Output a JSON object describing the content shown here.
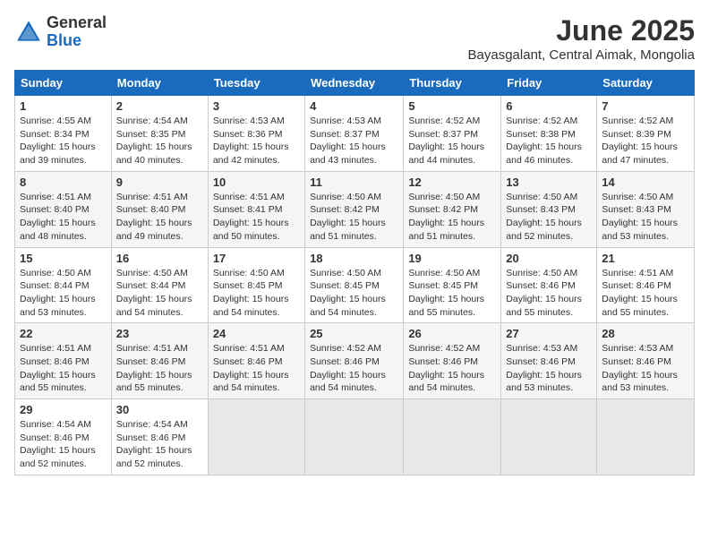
{
  "header": {
    "logo_general": "General",
    "logo_blue": "Blue",
    "month_year": "June 2025",
    "location": "Bayasgalant, Central Aimak, Mongolia"
  },
  "calendar": {
    "weekdays": [
      "Sunday",
      "Monday",
      "Tuesday",
      "Wednesday",
      "Thursday",
      "Friday",
      "Saturday"
    ],
    "weeks": [
      [
        {
          "day": "1",
          "info": "Sunrise: 4:55 AM\nSunset: 8:34 PM\nDaylight: 15 hours\nand 39 minutes."
        },
        {
          "day": "2",
          "info": "Sunrise: 4:54 AM\nSunset: 8:35 PM\nDaylight: 15 hours\nand 40 minutes."
        },
        {
          "day": "3",
          "info": "Sunrise: 4:53 AM\nSunset: 8:36 PM\nDaylight: 15 hours\nand 42 minutes."
        },
        {
          "day": "4",
          "info": "Sunrise: 4:53 AM\nSunset: 8:37 PM\nDaylight: 15 hours\nand 43 minutes."
        },
        {
          "day": "5",
          "info": "Sunrise: 4:52 AM\nSunset: 8:37 PM\nDaylight: 15 hours\nand 44 minutes."
        },
        {
          "day": "6",
          "info": "Sunrise: 4:52 AM\nSunset: 8:38 PM\nDaylight: 15 hours\nand 46 minutes."
        },
        {
          "day": "7",
          "info": "Sunrise: 4:52 AM\nSunset: 8:39 PM\nDaylight: 15 hours\nand 47 minutes."
        }
      ],
      [
        {
          "day": "8",
          "info": "Sunrise: 4:51 AM\nSunset: 8:40 PM\nDaylight: 15 hours\nand 48 minutes."
        },
        {
          "day": "9",
          "info": "Sunrise: 4:51 AM\nSunset: 8:40 PM\nDaylight: 15 hours\nand 49 minutes."
        },
        {
          "day": "10",
          "info": "Sunrise: 4:51 AM\nSunset: 8:41 PM\nDaylight: 15 hours\nand 50 minutes."
        },
        {
          "day": "11",
          "info": "Sunrise: 4:50 AM\nSunset: 8:42 PM\nDaylight: 15 hours\nand 51 minutes."
        },
        {
          "day": "12",
          "info": "Sunrise: 4:50 AM\nSunset: 8:42 PM\nDaylight: 15 hours\nand 51 minutes."
        },
        {
          "day": "13",
          "info": "Sunrise: 4:50 AM\nSunset: 8:43 PM\nDaylight: 15 hours\nand 52 minutes."
        },
        {
          "day": "14",
          "info": "Sunrise: 4:50 AM\nSunset: 8:43 PM\nDaylight: 15 hours\nand 53 minutes."
        }
      ],
      [
        {
          "day": "15",
          "info": "Sunrise: 4:50 AM\nSunset: 8:44 PM\nDaylight: 15 hours\nand 53 minutes."
        },
        {
          "day": "16",
          "info": "Sunrise: 4:50 AM\nSunset: 8:44 PM\nDaylight: 15 hours\nand 54 minutes."
        },
        {
          "day": "17",
          "info": "Sunrise: 4:50 AM\nSunset: 8:45 PM\nDaylight: 15 hours\nand 54 minutes."
        },
        {
          "day": "18",
          "info": "Sunrise: 4:50 AM\nSunset: 8:45 PM\nDaylight: 15 hours\nand 54 minutes."
        },
        {
          "day": "19",
          "info": "Sunrise: 4:50 AM\nSunset: 8:45 PM\nDaylight: 15 hours\nand 55 minutes."
        },
        {
          "day": "20",
          "info": "Sunrise: 4:50 AM\nSunset: 8:46 PM\nDaylight: 15 hours\nand 55 minutes."
        },
        {
          "day": "21",
          "info": "Sunrise: 4:51 AM\nSunset: 8:46 PM\nDaylight: 15 hours\nand 55 minutes."
        }
      ],
      [
        {
          "day": "22",
          "info": "Sunrise: 4:51 AM\nSunset: 8:46 PM\nDaylight: 15 hours\nand 55 minutes."
        },
        {
          "day": "23",
          "info": "Sunrise: 4:51 AM\nSunset: 8:46 PM\nDaylight: 15 hours\nand 55 minutes."
        },
        {
          "day": "24",
          "info": "Sunrise: 4:51 AM\nSunset: 8:46 PM\nDaylight: 15 hours\nand 54 minutes."
        },
        {
          "day": "25",
          "info": "Sunrise: 4:52 AM\nSunset: 8:46 PM\nDaylight: 15 hours\nand 54 minutes."
        },
        {
          "day": "26",
          "info": "Sunrise: 4:52 AM\nSunset: 8:46 PM\nDaylight: 15 hours\nand 54 minutes."
        },
        {
          "day": "27",
          "info": "Sunrise: 4:53 AM\nSunset: 8:46 PM\nDaylight: 15 hours\nand 53 minutes."
        },
        {
          "day": "28",
          "info": "Sunrise: 4:53 AM\nSunset: 8:46 PM\nDaylight: 15 hours\nand 53 minutes."
        }
      ],
      [
        {
          "day": "29",
          "info": "Sunrise: 4:54 AM\nSunset: 8:46 PM\nDaylight: 15 hours\nand 52 minutes."
        },
        {
          "day": "30",
          "info": "Sunrise: 4:54 AM\nSunset: 8:46 PM\nDaylight: 15 hours\nand 52 minutes."
        },
        {
          "day": "",
          "info": ""
        },
        {
          "day": "",
          "info": ""
        },
        {
          "day": "",
          "info": ""
        },
        {
          "day": "",
          "info": ""
        },
        {
          "day": "",
          "info": ""
        }
      ]
    ]
  }
}
